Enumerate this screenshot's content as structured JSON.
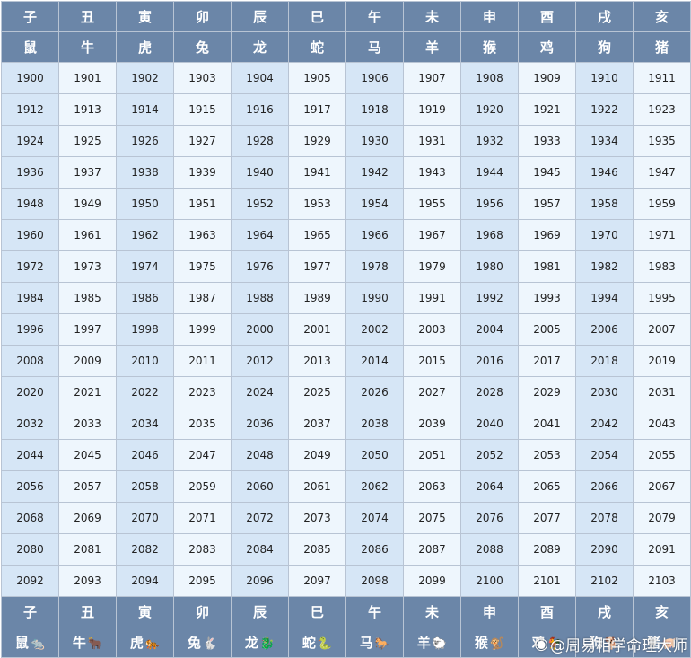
{
  "branches": [
    "子",
    "丑",
    "寅",
    "卯",
    "辰",
    "巳",
    "午",
    "未",
    "申",
    "酉",
    "戌",
    "亥"
  ],
  "animals": [
    "鼠",
    "牛",
    "虎",
    "兔",
    "龙",
    "蛇",
    "马",
    "羊",
    "猴",
    "鸡",
    "狗",
    "猪"
  ],
  "animal_icons": [
    "🐀",
    "🐂",
    "🐅",
    "🐇",
    "🐉",
    "🐍",
    "🐎",
    "🐑",
    "🐒",
    "🐓",
    "🐕",
    "🐖"
  ],
  "years": [
    [
      "1900",
      "1901",
      "1902",
      "1903",
      "1904",
      "1905",
      "1906",
      "1907",
      "1908",
      "1909",
      "1910",
      "1911"
    ],
    [
      "1912",
      "1913",
      "1914",
      "1915",
      "1916",
      "1917",
      "1918",
      "1919",
      "1920",
      "1921",
      "1922",
      "1923"
    ],
    [
      "1924",
      "1925",
      "1926",
      "1927",
      "1928",
      "1929",
      "1930",
      "1931",
      "1932",
      "1933",
      "1934",
      "1935"
    ],
    [
      "1936",
      "1937",
      "1938",
      "1939",
      "1940",
      "1941",
      "1942",
      "1943",
      "1944",
      "1945",
      "1946",
      "1947"
    ],
    [
      "1948",
      "1949",
      "1950",
      "1951",
      "1952",
      "1953",
      "1954",
      "1955",
      "1956",
      "1957",
      "1958",
      "1959"
    ],
    [
      "1960",
      "1961",
      "1962",
      "1963",
      "1964",
      "1965",
      "1966",
      "1967",
      "1968",
      "1969",
      "1970",
      "1971"
    ],
    [
      "1972",
      "1973",
      "1974",
      "1975",
      "1976",
      "1977",
      "1978",
      "1979",
      "1980",
      "1981",
      "1982",
      "1983"
    ],
    [
      "1984",
      "1985",
      "1986",
      "1987",
      "1988",
      "1989",
      "1990",
      "1991",
      "1992",
      "1993",
      "1994",
      "1995"
    ],
    [
      "1996",
      "1997",
      "1998",
      "1999",
      "2000",
      "2001",
      "2002",
      "2003",
      "2004",
      "2005",
      "2006",
      "2007"
    ],
    [
      "2008",
      "2009",
      "2010",
      "2011",
      "2012",
      "2013",
      "2014",
      "2015",
      "2016",
      "2017",
      "2018",
      "2019"
    ],
    [
      "2020",
      "2021",
      "2022",
      "2023",
      "2024",
      "2025",
      "2026",
      "2027",
      "2028",
      "2029",
      "2030",
      "2031"
    ],
    [
      "2032",
      "2033",
      "2034",
      "2035",
      "2036",
      "2037",
      "2038",
      "2039",
      "2040",
      "2041",
      "2042",
      "2043"
    ],
    [
      "2044",
      "2045",
      "2046",
      "2047",
      "2048",
      "2049",
      "2050",
      "2051",
      "2052",
      "2053",
      "2054",
      "2055"
    ],
    [
      "2056",
      "2057",
      "2058",
      "2059",
      "2060",
      "2061",
      "2062",
      "2063",
      "2064",
      "2065",
      "2066",
      "2067"
    ],
    [
      "2068",
      "2069",
      "2070",
      "2071",
      "2072",
      "2073",
      "2074",
      "2075",
      "2076",
      "2077",
      "2078",
      "2079"
    ],
    [
      "2080",
      "2081",
      "2082",
      "2083",
      "2084",
      "2085",
      "2086",
      "2087",
      "2088",
      "2089",
      "2090",
      "2091"
    ],
    [
      "2092",
      "2093",
      "2094",
      "2095",
      "2096",
      "2097",
      "2098",
      "2099",
      "2100",
      "2101",
      "2102",
      "2103"
    ]
  ],
  "watermark": "@周易相学命理大师",
  "watermark_icon": "weibo-logo-icon",
  "colors": {
    "header_bg": "#6b86a8",
    "header_text": "#ffffff",
    "cell_dark": "#d6e6f6",
    "cell_light": "#eef6fd",
    "border": "#b8c4d4"
  }
}
